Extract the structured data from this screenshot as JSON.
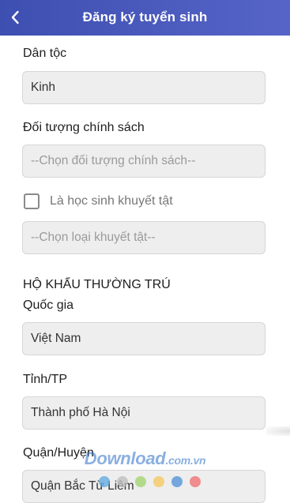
{
  "header": {
    "title": "Đăng ký tuyển sinh",
    "back_icon": "chevron-left-icon",
    "background": "#4a5abf"
  },
  "form": {
    "ethnicity": {
      "label": "Dân tộc",
      "value": "Kinh"
    },
    "policy": {
      "label": "Đối tượng chính sách",
      "placeholder": "--Chọn đối tượng chính sách--"
    },
    "disabled_student": {
      "label": "Là học sinh khuyết tật",
      "checked": false
    },
    "disability_type": {
      "placeholder": "--Chọn loại khuyết tật--"
    },
    "residence_section": "HỘ KHẨU THƯỜNG TRÚ",
    "country": {
      "label": "Quốc gia",
      "value": "Việt Nam"
    },
    "province": {
      "label": "Tỉnh/TP",
      "value": "Thành phố Hà Nội"
    },
    "district": {
      "label": "Quận/Huyện",
      "value": "Quận Bắc Từ Liêm"
    }
  },
  "watermark": {
    "text": "Download",
    "suffix": ".com.vn",
    "dot_colors": [
      "#5aa7e0",
      "#bcbcbc",
      "#9fd36a",
      "#f6c65a",
      "#4a8fd8",
      "#ef6b6b"
    ]
  }
}
